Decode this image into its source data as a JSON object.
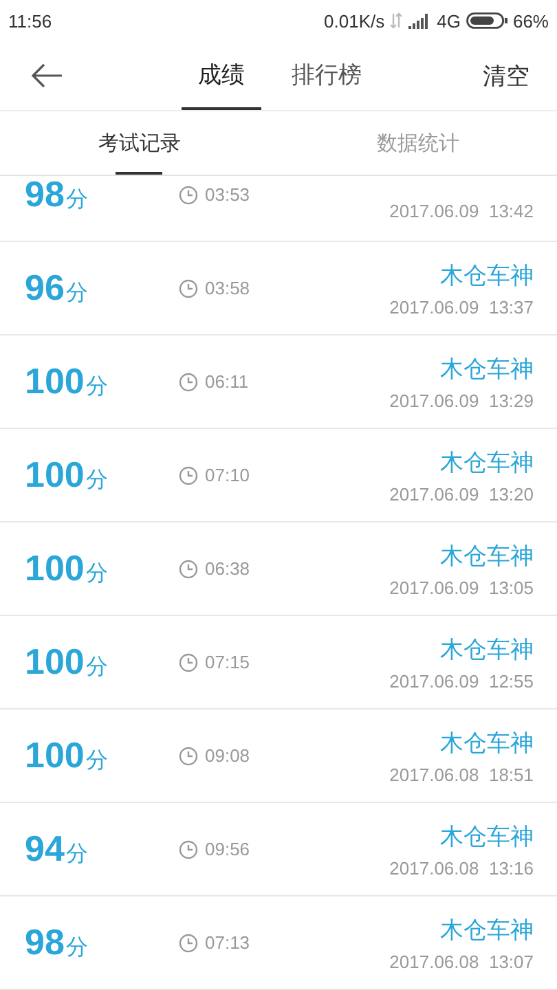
{
  "status_bar": {
    "time": "11:56",
    "speed": "0.01K/s",
    "network": "4G",
    "battery": "66%"
  },
  "header": {
    "tabs": [
      {
        "label": "成绩",
        "selected": true
      },
      {
        "label": "排行榜",
        "selected": false
      }
    ],
    "action": "清空"
  },
  "sub_tabs": [
    {
      "label": "考试记录",
      "selected": true
    },
    {
      "label": "数据统计",
      "selected": false
    }
  ],
  "records": [
    {
      "score": "98",
      "unit": "分",
      "duration": "03:53",
      "date": "2017.06.09  13:42"
    },
    {
      "score": "96",
      "unit": "分",
      "duration": "03:58",
      "title": "木仓车神",
      "date": "2017.06.09  13:37"
    },
    {
      "score": "100",
      "unit": "分",
      "duration": "06:11",
      "title": "木仓车神",
      "date": "2017.06.09  13:29"
    },
    {
      "score": "100",
      "unit": "分",
      "duration": "07:10",
      "title": "木仓车神",
      "date": "2017.06.09  13:20"
    },
    {
      "score": "100",
      "unit": "分",
      "duration": "06:38",
      "title": "木仓车神",
      "date": "2017.06.09  13:05"
    },
    {
      "score": "100",
      "unit": "分",
      "duration": "07:15",
      "title": "木仓车神",
      "date": "2017.06.09  12:55"
    },
    {
      "score": "100",
      "unit": "分",
      "duration": "09:08",
      "title": "木仓车神",
      "date": "2017.06.08  18:51"
    },
    {
      "score": "94",
      "unit": "分",
      "duration": "09:56",
      "title": "木仓车神",
      "date": "2017.06.08  13:16"
    },
    {
      "score": "98",
      "unit": "分",
      "duration": "07:13",
      "title": "木仓车神",
      "date": "2017.06.08  13:07"
    }
  ]
}
